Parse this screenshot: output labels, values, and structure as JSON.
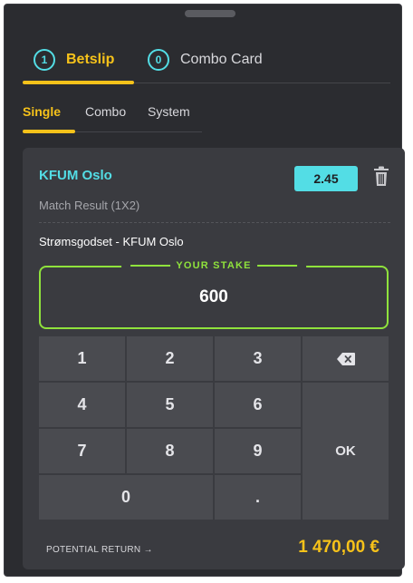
{
  "tabs": {
    "betslip": {
      "count": "1",
      "label": "Betslip"
    },
    "combo_card": {
      "count": "0",
      "label": "Combo Card"
    }
  },
  "subtabs": [
    "Single",
    "Combo",
    "System"
  ],
  "selection": {
    "team": "KFUM Oslo",
    "market": "Match Result (1X2)",
    "odds": "2.45",
    "match": "Strømsgodset - KFUM Oslo"
  },
  "stake": {
    "label": "YOUR STAKE",
    "value": "600"
  },
  "keypad": {
    "keys": [
      "1",
      "2",
      "3",
      "4",
      "5",
      "6",
      "7",
      "8",
      "9",
      "0",
      "."
    ],
    "ok_label": "OK"
  },
  "potential_return": {
    "label": "POTENTIAL RETURN →",
    "value": "1 470,00 €"
  },
  "colors": {
    "accent_yellow": "#f6c21a",
    "accent_cyan": "#53dde5",
    "stake_green": "#8fe23c",
    "panel_bg": "#2b2c30",
    "card_bg": "#3a3b40",
    "key_bg": "#4a4b50"
  },
  "icons": {
    "trash": "trash-icon",
    "backspace": "backspace-icon"
  }
}
